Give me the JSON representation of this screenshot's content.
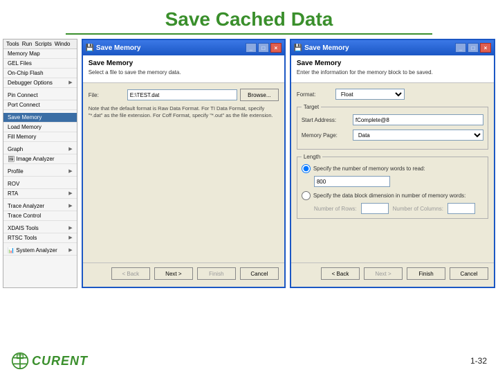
{
  "title": "Save Cached Data",
  "page_number": "1-32",
  "logo_name": "CURENT",
  "tools": {
    "menubar": [
      "Tools",
      "Run",
      "Scripts",
      "Windo"
    ],
    "items": [
      {
        "label": "Memory Map",
        "sub": false
      },
      {
        "label": "GEL Files",
        "sub": false
      },
      {
        "label": "On-Chip Flash",
        "sub": false
      },
      {
        "label": "Debugger Options",
        "sub": true
      },
      {
        "label": "Pin Connect",
        "sub": false
      },
      {
        "label": "Port Connect",
        "sub": false
      },
      {
        "label": "Save Memory",
        "sub": false,
        "selected": true
      },
      {
        "label": "Load Memory",
        "sub": false
      },
      {
        "label": "Fill Memory",
        "sub": false
      },
      {
        "label": "Graph",
        "sub": true
      },
      {
        "label": "Image Analyzer",
        "sub": false,
        "icon": "image"
      },
      {
        "label": "Profile",
        "sub": true
      },
      {
        "label": "ROV",
        "sub": false
      },
      {
        "label": "RTA",
        "sub": true
      },
      {
        "label": "Trace Analyzer",
        "sub": true
      },
      {
        "label": "Trace Control",
        "sub": false
      },
      {
        "label": "XDAIS Tools",
        "sub": true
      },
      {
        "label": "RTSC Tools",
        "sub": true
      },
      {
        "label": "System Analyzer",
        "sub": true,
        "icon": "chart"
      }
    ]
  },
  "dialog1": {
    "window_title": "Save Memory",
    "heading": "Save Memory",
    "subtitle": "Select a file to save the memory data.",
    "file_label": "File:",
    "file_value": "E:\\TEST.dat",
    "browse": "Browse...",
    "note": "Note that the default format is Raw Data Format. For TI Data Format, specify \"*.dat\" as the file extension. For Coff Format, specify \"*.out\" as the file extension.",
    "back": "< Back",
    "next": "Next >",
    "finish": "Finish",
    "cancel": "Cancel"
  },
  "dialog2": {
    "window_title": "Save Memory",
    "heading": "Save Memory",
    "subtitle": "Enter the information for the memory block to be saved.",
    "format_label": "Format:",
    "format_value": "Float",
    "target_legend": "Target",
    "start_label": "Start Address:",
    "start_value": "fComplete@8",
    "page_label": "Memory Page:",
    "page_value": "Data",
    "length_legend": "Length",
    "opt1": "Specify the number of memory words to read:",
    "words": "800",
    "opt2": "Specify the data block dimension in number of memory words:",
    "rows_label": "Number of Rows:",
    "cols_label": "Number of Columns:",
    "back": "< Back",
    "next": "Next >",
    "finish": "Finish",
    "cancel": "Cancel"
  }
}
